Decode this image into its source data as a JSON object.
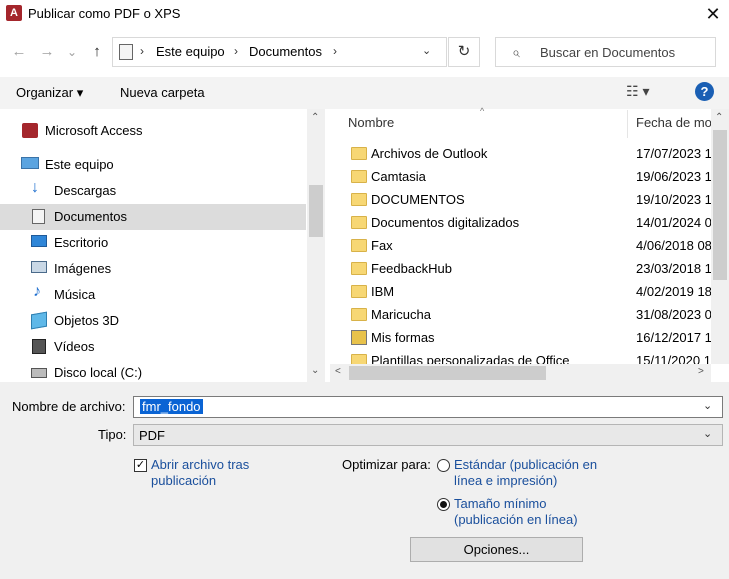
{
  "window": {
    "title": "Publicar como PDF o XPS",
    "app_icon_letter": "A",
    "close_glyph": "✕"
  },
  "nav": {
    "back_glyph": "←",
    "forward_glyph": "→",
    "recent_glyph": "⌄",
    "up_glyph": "↑",
    "breadcrumb": [
      "Este equipo",
      "Documentos"
    ],
    "separator": "›",
    "dropdown_glyph": "⌄",
    "refresh_glyph": "↻"
  },
  "search": {
    "placeholder": "Buscar en Documentos",
    "icon_glyph": "⌕"
  },
  "toolbar": {
    "organize_label": "Organizar",
    "organize_caret": "▾",
    "new_folder_label": "Nueva carpeta",
    "view_glyph": "☷ ▾",
    "help_glyph": "?"
  },
  "sidebar": {
    "items": [
      {
        "label": "Microsoft Access",
        "icon": "access-icon"
      },
      {
        "label": "Este equipo",
        "icon": "computer-icon"
      },
      {
        "label": "Descargas",
        "icon": "download-icon"
      },
      {
        "label": "Documentos",
        "icon": "document-icon",
        "selected": true
      },
      {
        "label": "Escritorio",
        "icon": "desktop-icon"
      },
      {
        "label": "Imágenes",
        "icon": "pictures-icon"
      },
      {
        "label": "Música",
        "icon": "music-icon"
      },
      {
        "label": "Objetos 3D",
        "icon": "cube-icon"
      },
      {
        "label": "Vídeos",
        "icon": "video-icon"
      },
      {
        "label": "Disco local (C:)",
        "icon": "drive-icon"
      }
    ]
  },
  "files": {
    "columns": {
      "name": "Nombre",
      "date": "Fecha de mo"
    },
    "rows": [
      {
        "name": "Archivos de Outlook",
        "date": "17/07/2023 1(",
        "type": "folder"
      },
      {
        "name": "Camtasia",
        "date": "19/06/2023 1!",
        "type": "folder"
      },
      {
        "name": "DOCUMENTOS",
        "date": "19/10/2023 1:",
        "type": "folder"
      },
      {
        "name": "Documentos digitalizados",
        "date": "14/01/2024 0(",
        "type": "folder"
      },
      {
        "name": "Fax",
        "date": "4/06/2018 08:",
        "type": "folder"
      },
      {
        "name": "FeedbackHub",
        "date": "23/03/2018 1.",
        "type": "folder"
      },
      {
        "name": "IBM",
        "date": "4/02/2019 18:",
        "type": "folder"
      },
      {
        "name": "Maricucha",
        "date": "31/08/2023 0(",
        "type": "folder"
      },
      {
        "name": "Mis formas",
        "date": "16/12/2017 1",
        "type": "shapes"
      },
      {
        "name": "Plantillas personalizadas de Office",
        "date": "15/11/2020 1/",
        "type": "folder"
      }
    ]
  },
  "form": {
    "filename_label": "Nombre de archivo:",
    "filename_value": "fmr_fondo",
    "type_label": "Tipo:",
    "type_value": "PDF",
    "caret_glyph": "⌄",
    "open_after_checked": true,
    "check_glyph": "✓",
    "open_after_label": "Abrir archivo tras publicación",
    "optimize_label": "Optimizar para:",
    "standard_label": "Estándar (publicación en línea e impresión)",
    "minimum_label": "Tamaño mínimo (publicación en línea)",
    "selected_option": "minimum",
    "options_button": "Opciones..."
  },
  "scroll": {
    "up": "⌃",
    "down": "⌄",
    "left": "<",
    "right": ">"
  }
}
